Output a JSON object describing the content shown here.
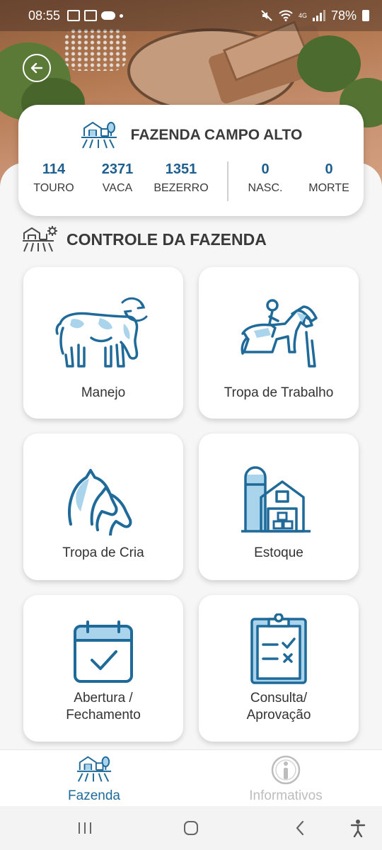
{
  "status_bar": {
    "time": "08:55",
    "network": "4G",
    "battery": "78%"
  },
  "farm": {
    "name": "FAZENDA CAMPO ALTO",
    "stats": [
      {
        "value": "114",
        "label": "TOURO"
      },
      {
        "value": "2371",
        "label": "VACA"
      },
      {
        "value": "1351",
        "label": "BEZERRO"
      },
      {
        "value": "0",
        "label": "NASC."
      },
      {
        "value": "0",
        "label": "MORTE"
      }
    ]
  },
  "section": {
    "title": "CONTROLE DA FAZENDA"
  },
  "tiles": [
    {
      "label": "Manejo",
      "icon": "cow-cycle-icon"
    },
    {
      "label": "Tropa de Trabalho",
      "icon": "horse-rider-icon"
    },
    {
      "label": "Tropa de Cria",
      "icon": "horse-heads-icon"
    },
    {
      "label": "Estoque",
      "icon": "barn-silo-icon"
    },
    {
      "label_line1": "Abertura /",
      "label_line2": "Fechamento",
      "icon": "calendar-check-icon"
    },
    {
      "label_line1": "Consulta/",
      "label_line2": "Aprovação",
      "icon": "clipboard-check-icon"
    }
  ],
  "bottom_nav": [
    {
      "label": "Fazenda",
      "icon": "farm-icon",
      "active": true
    },
    {
      "label": "Informativos",
      "icon": "info-icon",
      "active": false
    }
  ],
  "colors": {
    "accent": "#1f6a99",
    "icon_light": "#a9d4ec",
    "inactive": "#bdbdbd"
  }
}
